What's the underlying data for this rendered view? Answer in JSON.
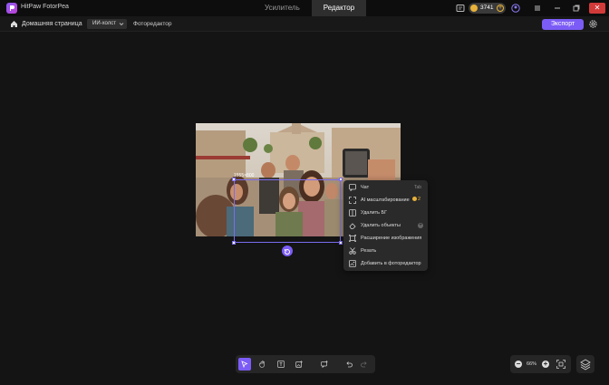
{
  "app": {
    "name": "HitPaw FotorPea"
  },
  "top_tabs": [
    {
      "label": "Усилитель",
      "active": false
    },
    {
      "label": "Редактор",
      "active": true
    }
  ],
  "credits": {
    "value": "3741"
  },
  "window_controls": {
    "close": "✕"
  },
  "subbar": {
    "home_label": "Домашняя страница",
    "mode": "ИИ-холст",
    "breadcrumb": "Фоторедактор",
    "export_label": "Экспорт"
  },
  "canvas": {
    "selection_size": "1555×800"
  },
  "context_menu": {
    "items": [
      {
        "label": "Чат",
        "shortcut": "Tab",
        "icon": "chat-icon"
      },
      {
        "label": "AI масштабирование",
        "badge": "2",
        "icon": "expand-icon"
      },
      {
        "label": "Удалить БГ",
        "icon": "remove-bg-icon"
      },
      {
        "label": "Удалить объекты",
        "icon": "eraser-icon"
      },
      {
        "label": "Расширение изображения",
        "icon": "image-extend-icon"
      },
      {
        "label": "Резать",
        "icon": "scissors-icon"
      },
      {
        "label": "Добавить в фоторедактор",
        "icon": "add-image-icon"
      }
    ]
  },
  "zoom": {
    "value": "66%"
  },
  "colors": {
    "accent": "#7c5cf6",
    "coin": "#e8b23a",
    "background": "#141414"
  }
}
